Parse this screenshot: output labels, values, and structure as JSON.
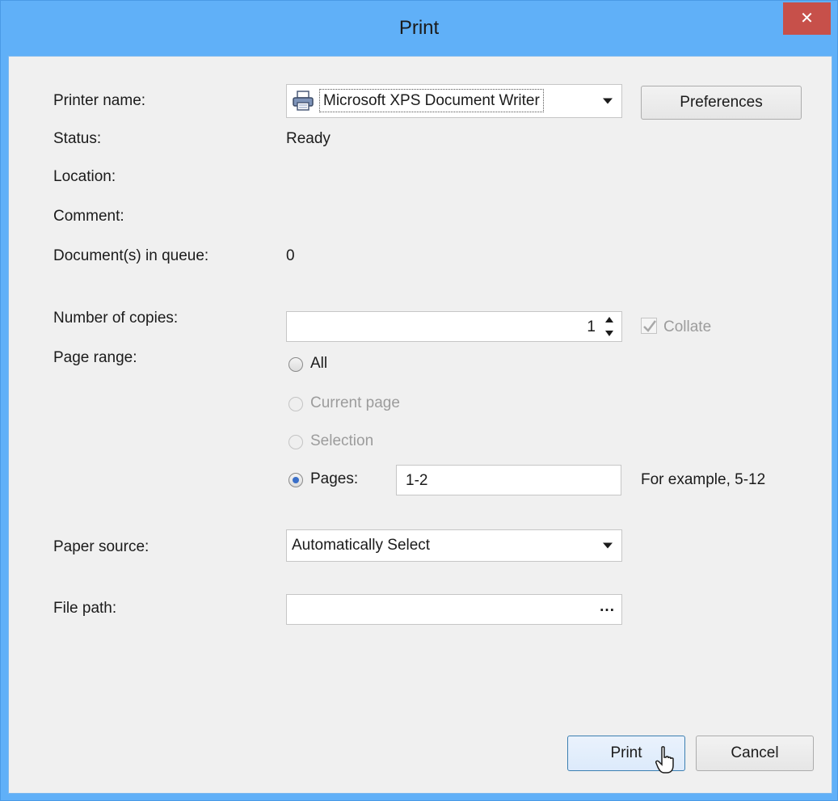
{
  "window": {
    "title": "Print",
    "close_glyph": "✕"
  },
  "labels": {
    "printer_name": "Printer name:",
    "status": "Status:",
    "location": "Location:",
    "comment": "Comment:",
    "docs_in_queue": "Document(s) in queue:",
    "number_of_copies": "Number of copies:",
    "page_range": "Page range:",
    "paper_source": "Paper source:",
    "file_path": "File path:"
  },
  "values": {
    "status": "Ready",
    "docs_in_queue": "0"
  },
  "printer": {
    "selected": "Microsoft XPS Document Writer",
    "icon": "printer-icon"
  },
  "buttons": {
    "preferences": "Preferences",
    "print": "Print",
    "cancel": "Cancel",
    "browse": "..."
  },
  "copies": {
    "value": "1",
    "collate_label": "Collate",
    "collate_checked": true
  },
  "page_range": {
    "options": [
      {
        "label": "All",
        "enabled": true,
        "selected": false
      },
      {
        "label": "Current page",
        "enabled": false,
        "selected": false
      },
      {
        "label": "Selection",
        "enabled": false,
        "selected": false
      },
      {
        "label": "Pages:",
        "enabled": true,
        "selected": true
      }
    ],
    "pages_value": "1-2",
    "example_hint": "For example, 5-12"
  },
  "paper_source": {
    "selected": "Automatically Select"
  },
  "file_path": {
    "value": ""
  },
  "colors": {
    "title_bar": "#60b0f8",
    "close_button": "#c7504a",
    "client_bg": "#f0f0f0",
    "radio_selected": "#3a6fc8"
  }
}
